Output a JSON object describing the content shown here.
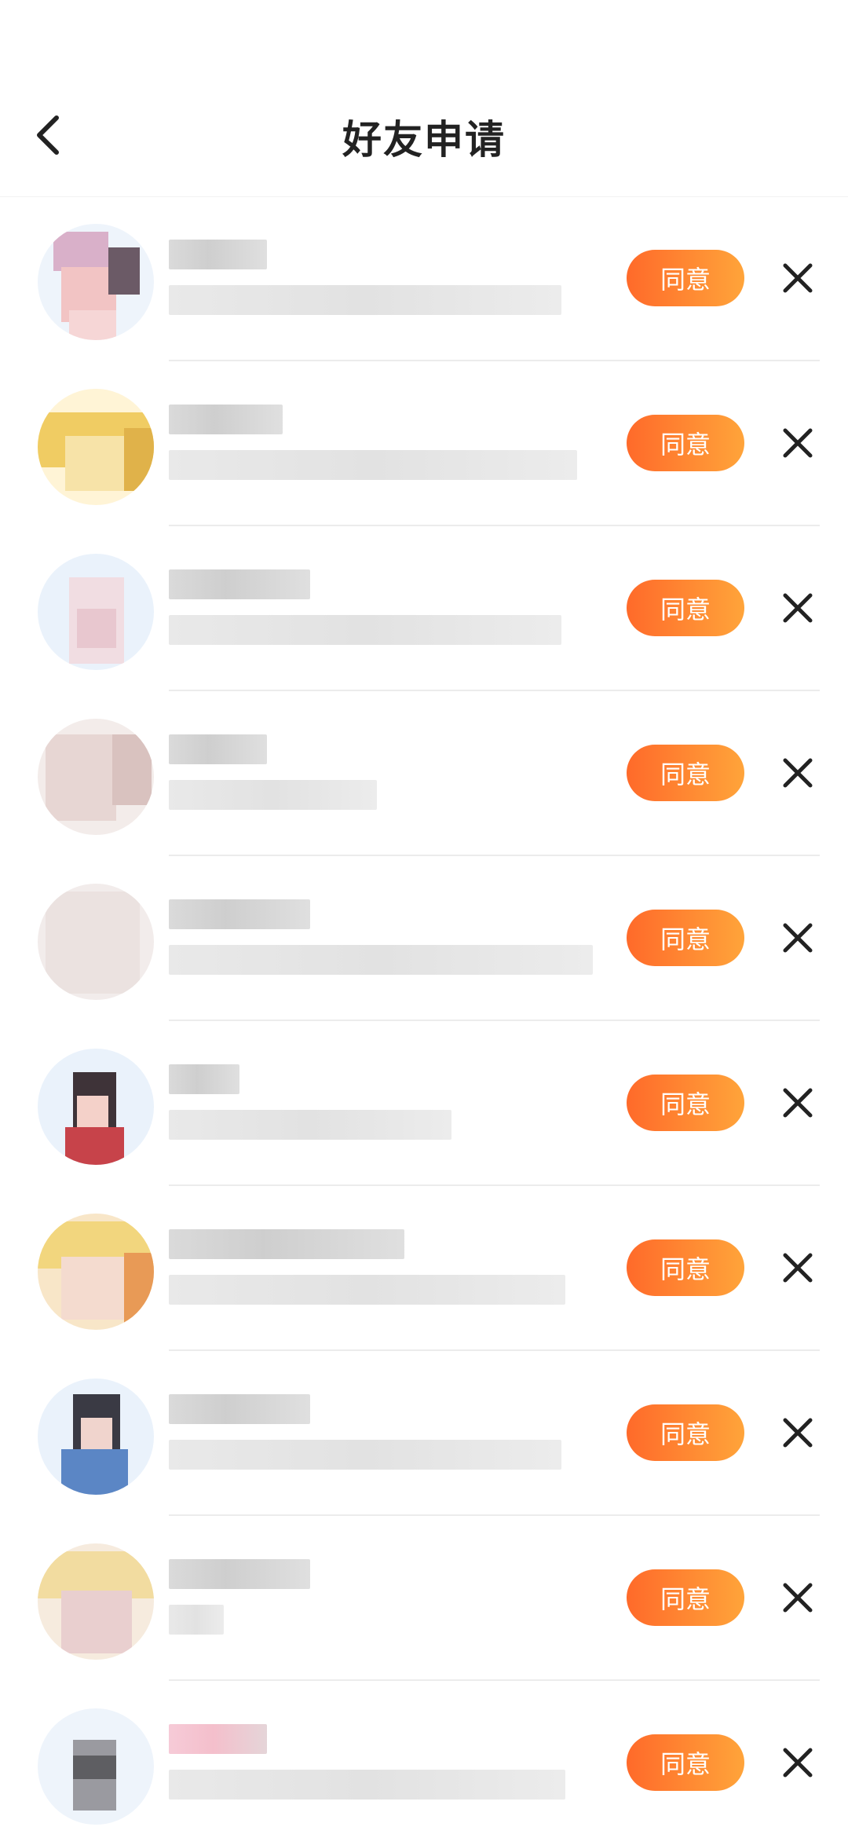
{
  "header": {
    "title": "好友申请"
  },
  "requests": [
    {
      "accept_label": "同意",
      "avatar": [
        "#d9b0c9",
        "#f2c4c4",
        "#6b5a66",
        "#f6d6d6"
      ]
    },
    {
      "accept_label": "同意",
      "avatar": [
        "#f0cc63",
        "#f7e3a8",
        "#e0b24a",
        "#fff4d6"
      ]
    },
    {
      "accept_label": "同意",
      "avatar": [
        "#f1dde2",
        "#e8c7cf",
        "#f8ecef",
        "#d9e6f2"
      ]
    },
    {
      "accept_label": "同意",
      "avatar": [
        "#e7d6d3",
        "#d9c2bf",
        "#efe4e2",
        "#c8b4b1"
      ]
    },
    {
      "accept_label": "同意",
      "avatar": [
        "#ebe2e0",
        "#e1d6d4",
        "#f2eceb",
        "#ddd2d0"
      ]
    },
    {
      "accept_label": "同意",
      "avatar": [
        "#c7434a",
        "#3e3338",
        "#f4d1c9",
        "#e45c5c"
      ]
    },
    {
      "accept_label": "同意",
      "avatar": [
        "#f2d67e",
        "#eab07d",
        "#f8e6c8",
        "#e89a56"
      ]
    },
    {
      "accept_label": "同意",
      "avatar": [
        "#3a3a44",
        "#5b86c5",
        "#f0d4cd",
        "#87b0e8"
      ]
    },
    {
      "accept_label": "同意",
      "avatar": [
        "#f2dca0",
        "#e9cfcf",
        "#f6ebde",
        "#d8c0a0"
      ]
    },
    {
      "accept_label": "同意",
      "avatar": [
        "#5e5e62",
        "#9a9aa0",
        "#f6f6f8",
        "#cfd4dc"
      ]
    }
  ]
}
